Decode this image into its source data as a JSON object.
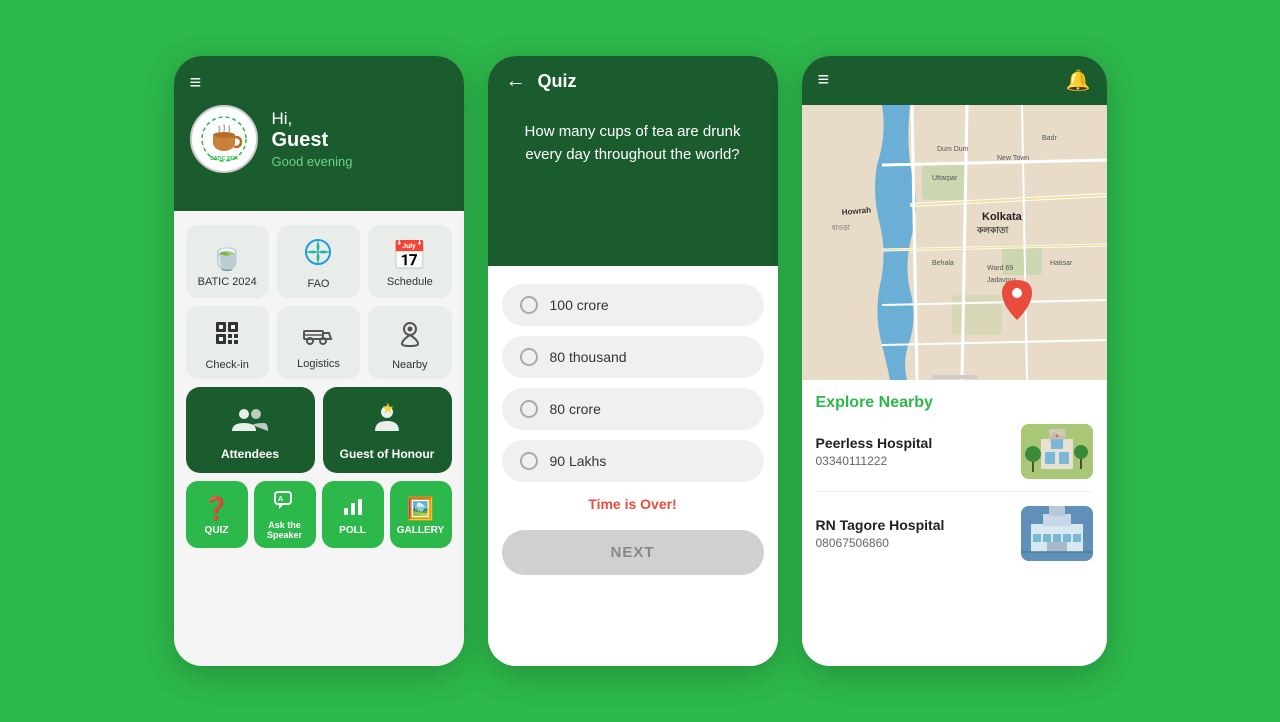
{
  "phone1": {
    "menu_icon": "≡",
    "greeting_hi": "Hi,",
    "greeting_name": "Guest",
    "greeting_sub": "Good evening",
    "grid_items": [
      {
        "id": "batic",
        "icon": "🍵",
        "label": "BATIC 2024"
      },
      {
        "id": "fao",
        "icon": "🌾",
        "label": "FAO"
      },
      {
        "id": "schedule",
        "icon": "📅",
        "label": "Schedule"
      }
    ],
    "grid_items2": [
      {
        "id": "checkin",
        "icon": "⬛",
        "label": "Check-in"
      },
      {
        "id": "logistics",
        "icon": "🚛",
        "label": "Logistics"
      },
      {
        "id": "nearby",
        "icon": "📍",
        "label": "Nearby"
      }
    ],
    "big_items": [
      {
        "id": "attendees",
        "icon": "👥",
        "label": "Attendees"
      },
      {
        "id": "guest",
        "icon": "🎖️",
        "label": "Guest of Honour"
      }
    ],
    "bottom_items": [
      {
        "id": "quiz",
        "icon": "❓",
        "label": "QUIZ"
      },
      {
        "id": "ask",
        "icon": "💬",
        "label": "Ask the Speaker"
      },
      {
        "id": "poll",
        "icon": "📊",
        "label": "POLL"
      },
      {
        "id": "gallery",
        "icon": "🖼️",
        "label": "GALLERY"
      }
    ]
  },
  "phone2": {
    "back_icon": "←",
    "title": "Quiz",
    "question": "How many cups of tea are drunk every day throughout the world?",
    "options": [
      {
        "id": "opt1",
        "text": "100 crore"
      },
      {
        "id": "opt2",
        "text": "80 thousand"
      },
      {
        "id": "opt3",
        "text": "80 crore"
      },
      {
        "id": "opt4",
        "text": "90 Lakhs"
      }
    ],
    "time_over": "Time is Over!",
    "next_label": "NEXT"
  },
  "phone3": {
    "menu_icon": "≡",
    "notif_icon": "🔔",
    "explore_title": "Explore Nearby",
    "hospitals": [
      {
        "id": "peerless",
        "name": "Peerless Hospital",
        "phone": "03340111222",
        "img_color": "#6ab04c"
      },
      {
        "id": "rn-tagore",
        "name": "RN Tagore Hospital",
        "phone": "08067506860",
        "img_color": "#3498db"
      }
    ]
  }
}
